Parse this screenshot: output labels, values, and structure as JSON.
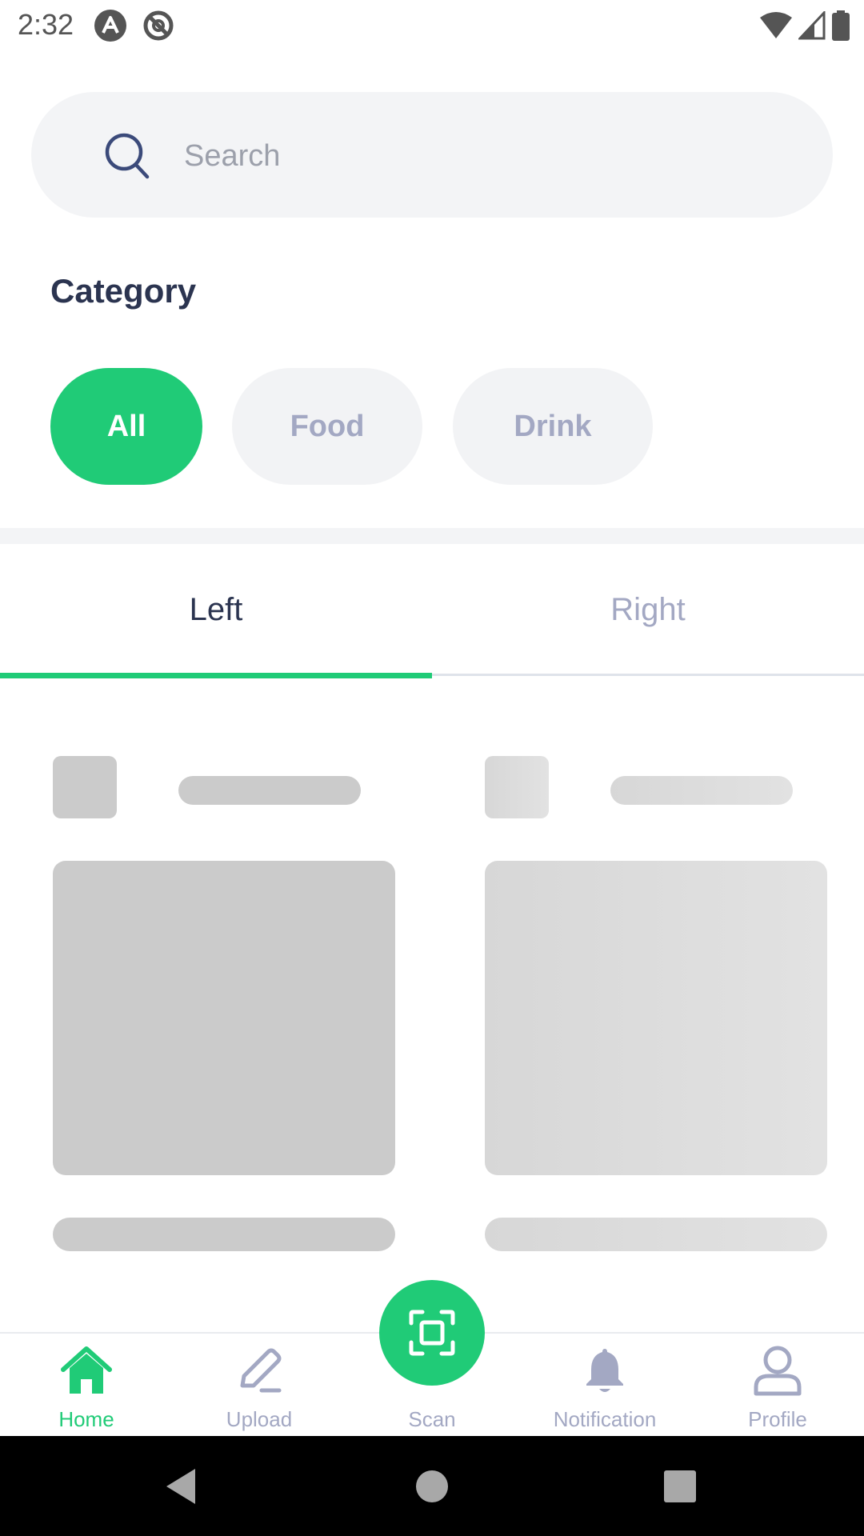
{
  "status_bar": {
    "time": "2:32",
    "icons": [
      "app-a-icon",
      "app-at-icon",
      "wifi-icon",
      "signal-icon",
      "battery-icon"
    ]
  },
  "search": {
    "placeholder": "Search",
    "value": ""
  },
  "category": {
    "title": "Category",
    "chips": [
      {
        "label": "All",
        "selected": true
      },
      {
        "label": "Food",
        "selected": false
      },
      {
        "label": "Drink",
        "selected": false
      }
    ]
  },
  "tabs": [
    {
      "label": "Left",
      "selected": true
    },
    {
      "label": "Right",
      "selected": false
    }
  ],
  "bottom_nav": {
    "items": [
      {
        "label": "Home",
        "icon": "home-icon",
        "active": true
      },
      {
        "label": "Upload",
        "icon": "pencil-icon",
        "active": false
      },
      {
        "label": "Scan",
        "icon": "scan-icon",
        "active": false
      },
      {
        "label": "Notification",
        "icon": "bell-icon",
        "active": false
      },
      {
        "label": "Profile",
        "icon": "user-icon",
        "active": false
      }
    ]
  },
  "colors": {
    "accent": "#20cb77",
    "text_dark": "#2b3450",
    "text_muted": "#a3a8c3",
    "surface": "#f3f4f6",
    "skeleton": "#cbcbcb"
  }
}
